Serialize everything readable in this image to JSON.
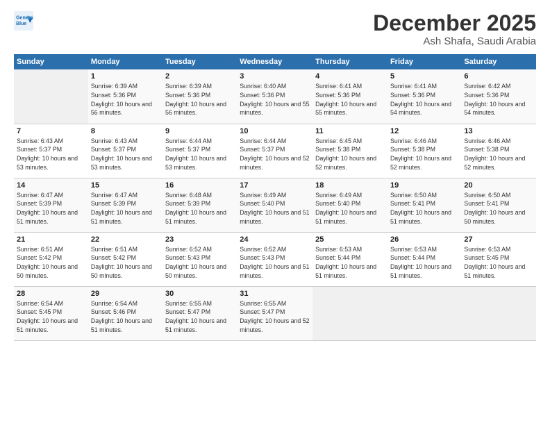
{
  "logo": {
    "line1": "General",
    "line2": "Blue"
  },
  "header": {
    "month": "December 2025",
    "location": "Ash Shafa, Saudi Arabia"
  },
  "weekdays": [
    "Sunday",
    "Monday",
    "Tuesday",
    "Wednesday",
    "Thursday",
    "Friday",
    "Saturday"
  ],
  "weeks": [
    [
      {
        "day": "",
        "sunrise": "",
        "sunset": "",
        "daylight": "",
        "empty": true
      },
      {
        "day": "1",
        "sunrise": "Sunrise: 6:39 AM",
        "sunset": "Sunset: 5:36 PM",
        "daylight": "Daylight: 10 hours and 56 minutes."
      },
      {
        "day": "2",
        "sunrise": "Sunrise: 6:39 AM",
        "sunset": "Sunset: 5:36 PM",
        "daylight": "Daylight: 10 hours and 56 minutes."
      },
      {
        "day": "3",
        "sunrise": "Sunrise: 6:40 AM",
        "sunset": "Sunset: 5:36 PM",
        "daylight": "Daylight: 10 hours and 55 minutes."
      },
      {
        "day": "4",
        "sunrise": "Sunrise: 6:41 AM",
        "sunset": "Sunset: 5:36 PM",
        "daylight": "Daylight: 10 hours and 55 minutes."
      },
      {
        "day": "5",
        "sunrise": "Sunrise: 6:41 AM",
        "sunset": "Sunset: 5:36 PM",
        "daylight": "Daylight: 10 hours and 54 minutes."
      },
      {
        "day": "6",
        "sunrise": "Sunrise: 6:42 AM",
        "sunset": "Sunset: 5:36 PM",
        "daylight": "Daylight: 10 hours and 54 minutes."
      }
    ],
    [
      {
        "day": "7",
        "sunrise": "Sunrise: 6:43 AM",
        "sunset": "Sunset: 5:37 PM",
        "daylight": "Daylight: 10 hours and 53 minutes."
      },
      {
        "day": "8",
        "sunrise": "Sunrise: 6:43 AM",
        "sunset": "Sunset: 5:37 PM",
        "daylight": "Daylight: 10 hours and 53 minutes."
      },
      {
        "day": "9",
        "sunrise": "Sunrise: 6:44 AM",
        "sunset": "Sunset: 5:37 PM",
        "daylight": "Daylight: 10 hours and 53 minutes."
      },
      {
        "day": "10",
        "sunrise": "Sunrise: 6:44 AM",
        "sunset": "Sunset: 5:37 PM",
        "daylight": "Daylight: 10 hours and 52 minutes."
      },
      {
        "day": "11",
        "sunrise": "Sunrise: 6:45 AM",
        "sunset": "Sunset: 5:38 PM",
        "daylight": "Daylight: 10 hours and 52 minutes."
      },
      {
        "day": "12",
        "sunrise": "Sunrise: 6:46 AM",
        "sunset": "Sunset: 5:38 PM",
        "daylight": "Daylight: 10 hours and 52 minutes."
      },
      {
        "day": "13",
        "sunrise": "Sunrise: 6:46 AM",
        "sunset": "Sunset: 5:38 PM",
        "daylight": "Daylight: 10 hours and 52 minutes."
      }
    ],
    [
      {
        "day": "14",
        "sunrise": "Sunrise: 6:47 AM",
        "sunset": "Sunset: 5:39 PM",
        "daylight": "Daylight: 10 hours and 51 minutes."
      },
      {
        "day": "15",
        "sunrise": "Sunrise: 6:47 AM",
        "sunset": "Sunset: 5:39 PM",
        "daylight": "Daylight: 10 hours and 51 minutes."
      },
      {
        "day": "16",
        "sunrise": "Sunrise: 6:48 AM",
        "sunset": "Sunset: 5:39 PM",
        "daylight": "Daylight: 10 hours and 51 minutes."
      },
      {
        "day": "17",
        "sunrise": "Sunrise: 6:49 AM",
        "sunset": "Sunset: 5:40 PM",
        "daylight": "Daylight: 10 hours and 51 minutes."
      },
      {
        "day": "18",
        "sunrise": "Sunrise: 6:49 AM",
        "sunset": "Sunset: 5:40 PM",
        "daylight": "Daylight: 10 hours and 51 minutes."
      },
      {
        "day": "19",
        "sunrise": "Sunrise: 6:50 AM",
        "sunset": "Sunset: 5:41 PM",
        "daylight": "Daylight: 10 hours and 51 minutes."
      },
      {
        "day": "20",
        "sunrise": "Sunrise: 6:50 AM",
        "sunset": "Sunset: 5:41 PM",
        "daylight": "Daylight: 10 hours and 50 minutes."
      }
    ],
    [
      {
        "day": "21",
        "sunrise": "Sunrise: 6:51 AM",
        "sunset": "Sunset: 5:42 PM",
        "daylight": "Daylight: 10 hours and 50 minutes."
      },
      {
        "day": "22",
        "sunrise": "Sunrise: 6:51 AM",
        "sunset": "Sunset: 5:42 PM",
        "daylight": "Daylight: 10 hours and 50 minutes."
      },
      {
        "day": "23",
        "sunrise": "Sunrise: 6:52 AM",
        "sunset": "Sunset: 5:43 PM",
        "daylight": "Daylight: 10 hours and 50 minutes."
      },
      {
        "day": "24",
        "sunrise": "Sunrise: 6:52 AM",
        "sunset": "Sunset: 5:43 PM",
        "daylight": "Daylight: 10 hours and 51 minutes."
      },
      {
        "day": "25",
        "sunrise": "Sunrise: 6:53 AM",
        "sunset": "Sunset: 5:44 PM",
        "daylight": "Daylight: 10 hours and 51 minutes."
      },
      {
        "day": "26",
        "sunrise": "Sunrise: 6:53 AM",
        "sunset": "Sunset: 5:44 PM",
        "daylight": "Daylight: 10 hours and 51 minutes."
      },
      {
        "day": "27",
        "sunrise": "Sunrise: 6:53 AM",
        "sunset": "Sunset: 5:45 PM",
        "daylight": "Daylight: 10 hours and 51 minutes."
      }
    ],
    [
      {
        "day": "28",
        "sunrise": "Sunrise: 6:54 AM",
        "sunset": "Sunset: 5:45 PM",
        "daylight": "Daylight: 10 hours and 51 minutes."
      },
      {
        "day": "29",
        "sunrise": "Sunrise: 6:54 AM",
        "sunset": "Sunset: 5:46 PM",
        "daylight": "Daylight: 10 hours and 51 minutes."
      },
      {
        "day": "30",
        "sunrise": "Sunrise: 6:55 AM",
        "sunset": "Sunset: 5:47 PM",
        "daylight": "Daylight: 10 hours and 51 minutes."
      },
      {
        "day": "31",
        "sunrise": "Sunrise: 6:55 AM",
        "sunset": "Sunset: 5:47 PM",
        "daylight": "Daylight: 10 hours and 52 minutes."
      },
      {
        "day": "",
        "sunrise": "",
        "sunset": "",
        "daylight": "",
        "empty": true
      },
      {
        "day": "",
        "sunrise": "",
        "sunset": "",
        "daylight": "",
        "empty": true
      },
      {
        "day": "",
        "sunrise": "",
        "sunset": "",
        "daylight": "",
        "empty": true
      }
    ]
  ]
}
